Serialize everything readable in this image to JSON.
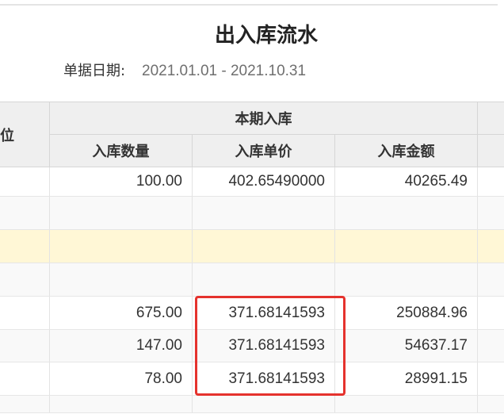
{
  "report": {
    "title": "出入库流水",
    "date_label": "单据日期:",
    "date_range": "2021.01.01 - 2021.10.31"
  },
  "table": {
    "left_header": "位",
    "group_header": "本期入库",
    "columns": [
      "入库数量",
      "入库单价",
      "入库金额"
    ],
    "rows": [
      {
        "qty": "100.00",
        "price": "402.65490000",
        "amount": "40265.49",
        "highlight": false
      },
      {
        "qty": "",
        "price": "",
        "amount": "",
        "highlight": false
      },
      {
        "qty": "",
        "price": "",
        "amount": "",
        "highlight": true
      },
      {
        "qty": "",
        "price": "",
        "amount": "",
        "highlight": false
      },
      {
        "qty": "675.00",
        "price": "371.68141593",
        "amount": "250884.96",
        "highlight": false
      },
      {
        "qty": "147.00",
        "price": "371.68141593",
        "amount": "54637.17",
        "highlight": false
      },
      {
        "qty": "78.00",
        "price": "371.68141593",
        "amount": "28991.15",
        "highlight": false
      },
      {
        "qty": "",
        "price": "",
        "amount": "",
        "highlight": false
      }
    ]
  },
  "outlined_rows": [
    4,
    5,
    6
  ],
  "colors": {
    "header_bg": "#efefef",
    "row": "#ffffff",
    "stripe_row": "#f9f9f9",
    "highlight_row": "#fff7d6",
    "annotation_red": "#e5322d"
  }
}
